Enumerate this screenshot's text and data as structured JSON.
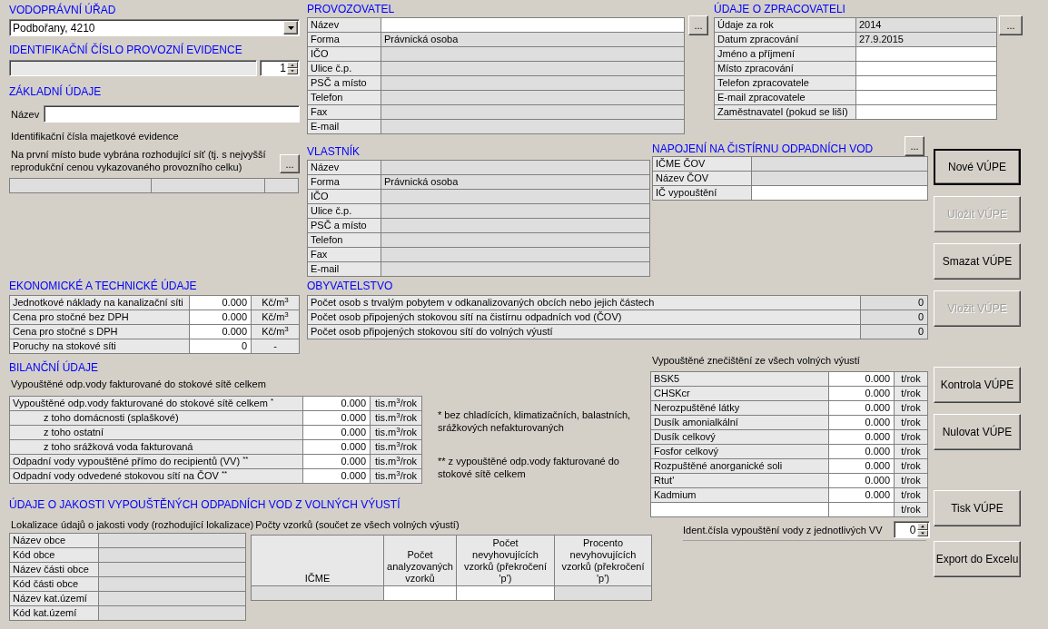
{
  "water_authority": {
    "heading": "VODOPRÁVNÍ ÚŘAD",
    "value": "Podbořany, 4210"
  },
  "operating_id": {
    "heading": "IDENTIFIKAČNÍ ČÍSLO PROVOZNÍ EVIDENCE",
    "spinner": "1"
  },
  "basic": {
    "heading": "ZÁKLADNÍ ÚDAJE",
    "name_label": "Název",
    "property_ids_label": "Identifikační čísla majetkové evidence",
    "note": "Na první místo bude vybrána rozhodující síť (tj. s nejvyšší reprodukční cenou vykazovaného provozního celku)",
    "browse": "..."
  },
  "operator": {
    "heading": "PROVOZOVATEL",
    "browse": "...",
    "rows": [
      {
        "label": "Název",
        "editable": true
      },
      {
        "label": "Forma",
        "value": "Právnická osoba",
        "editable": false
      },
      {
        "label": "IČO",
        "editable": false
      },
      {
        "label": "Ulice č.p.",
        "editable": false
      },
      {
        "label": "PSČ a místo",
        "editable": false
      },
      {
        "label": "Telefon",
        "editable": false
      },
      {
        "label": "Fax",
        "editable": false
      },
      {
        "label": "E-mail",
        "editable": false
      }
    ]
  },
  "processor": {
    "heading": "ÚDAJE O ZPRACOVATELI",
    "browse": "...",
    "rows": [
      {
        "label": "Údaje za rok",
        "value": "2014",
        "editable": false
      },
      {
        "label": "Datum zpracování",
        "value": "27.9.2015",
        "editable": false
      },
      {
        "label": "Jméno a příjmení",
        "editable": true
      },
      {
        "label": "Místo zpracování",
        "editable": true
      },
      {
        "label": "Telefon zpracovatele",
        "editable": true
      },
      {
        "label": "E-mail zpracovatele",
        "editable": true
      },
      {
        "label": "Zaměstnavatel (pokud se liší)",
        "editable": true
      }
    ]
  },
  "owner": {
    "heading": "VLASTNÍK",
    "rows": [
      {
        "label": "Název",
        "editable": false
      },
      {
        "label": "Forma",
        "value": "Právnická osoba",
        "editable": false
      },
      {
        "label": "IČO",
        "editable": false
      },
      {
        "label": "Ulice č.p.",
        "editable": false
      },
      {
        "label": "PSČ a místo",
        "editable": false
      },
      {
        "label": "Telefon",
        "editable": false
      },
      {
        "label": "Fax",
        "editable": false
      },
      {
        "label": "E-mail",
        "editable": false
      }
    ]
  },
  "treatment_plant": {
    "heading": "NAPOJENÍ NA ČISTÍRNU ODPADNÍCH VOD",
    "browse": "...",
    "rows": [
      {
        "label": "IČME ČOV",
        "editable": false
      },
      {
        "label": "Název ČOV",
        "editable": false
      },
      {
        "label": "IČ vypouštění",
        "editable": true
      }
    ]
  },
  "economic": {
    "heading": "EKONOMICKÉ A TECHNICKÉ ÚDAJE",
    "rows": [
      {
        "label": "Jednotkové náklady na kanalizační síti",
        "value": "0.000",
        "unit": "Kč/m$^{3}$"
      },
      {
        "label": "Cena pro stočné bez DPH",
        "value": "0.000",
        "unit": "Kč/m$^{3}$"
      },
      {
        "label": "Cena pro stočné s DPH",
        "value": "0.000",
        "unit": "Kč/m$^{3}$"
      },
      {
        "label": "Poruchy na stokové síti",
        "value": "0",
        "unit": "-"
      }
    ]
  },
  "population": {
    "heading": "OBYVATELSTVO",
    "rows": [
      {
        "label": "Počet osob s trvalým pobytem v odkanalizovaných obcích nebo jejich částech",
        "value": "0"
      },
      {
        "label": "Počet osob připojených stokovou sítí na čistírnu odpadních vod (ČOV)",
        "value": "0"
      },
      {
        "label": "Počet osob připojených stokovou sítí do volných výustí",
        "value": "0"
      }
    ]
  },
  "balance": {
    "heading": "BILANČNÍ ÚDAJE",
    "subheading": "Vypouštěné odp.vody fakturované do stokové sítě celkem",
    "rows": [
      {
        "label": "Vypouštěné odp.vody fakturované do stokové sítě celkem $^{*}$",
        "value": "0.000",
        "unit": "tis.m$^{3}$/rok",
        "children": [
          {
            "label": "z toho domácnosti (splaškové)",
            "value": "0.000",
            "unit": "tis.m$^{3}$/rok"
          },
          {
            "label": "z toho ostatní",
            "value": "0.000",
            "unit": "tis.m$^{3}$/rok"
          },
          {
            "label": "z toho srážková voda fakturovaná",
            "value": "0.000",
            "unit": "tis.m$^{3}$/rok"
          }
        ]
      },
      {
        "label": "Odpadní vody vypouštěné přímo do recipientů (VV) $^{**}$",
        "value": "0.000",
        "unit": "tis.m$^{3}$/rok"
      },
      {
        "label": "Odpadní vody odvedené stokovou sítí na ČOV $^{**}$",
        "value": "0.000",
        "unit": "tis.m$^{3}$/rok"
      }
    ],
    "notes": [
      "* bez chladících, klimatizačních, balastních, srážkových nefakturovaných",
      "** z vypouštěné odp.vody fakturované do stokové sítě celkem"
    ]
  },
  "pollution": {
    "heading": "Vypouštěné znečištění ze všech volných výustí",
    "rows": [
      {
        "label": "BSK5",
        "value": "0.000",
        "unit": "t/rok"
      },
      {
        "label": "CHSKcr",
        "value": "0.000",
        "unit": "t/rok"
      },
      {
        "label": "Nerozpuštěné látky",
        "value": "0.000",
        "unit": "t/rok"
      },
      {
        "label": "Dusík amonialkální",
        "value": "0.000",
        "unit": "t/rok"
      },
      {
        "label": "Dusík celkový",
        "value": "0.000",
        "unit": "t/rok"
      },
      {
        "label": "Fosfor celkový",
        "value": "0.000",
        "unit": "t/rok"
      },
      {
        "label": "Rozpuštěné anorganické soli",
        "value": "0.000",
        "unit": "t/rok"
      },
      {
        "label": "Rtut'",
        "value": "0.000",
        "unit": "t/rok"
      },
      {
        "label": "Kadmium",
        "value": "0.000",
        "unit": "t/rok"
      },
      {
        "unit": "t/rok"
      }
    ],
    "ident_label": "Ident.čísla vypouštění vody z jednotlivých VV",
    "ident_spinner": "0"
  },
  "quality": {
    "heading": "ÚDAJE O JAKOSTI VYPOUŠTĚNÝCH ODPADNÍCH VOD Z VOLNÝCH VÝUSTÍ",
    "location_label": "Lokalizace údajů o jakosti vody (rozhodující lokalizace)",
    "location_rows": [
      {
        "label": "Název obce"
      },
      {
        "label": "Kód obce"
      },
      {
        "label": "Název části obce"
      },
      {
        "label": "Kód části obce"
      },
      {
        "label": "Název kat.území"
      },
      {
        "label": "Kód kat.území"
      }
    ],
    "samples_label": "Počty vzorků (součet ze všech volných výustí)",
    "columns": [
      "IČME",
      "Počet analyzovaných vzorků",
      "Počet nevyhovujících vzorků (překročení 'p')",
      "Procento nevyhovujících vzorků (překročení 'p')"
    ],
    "row_editable": [
      false,
      true,
      true,
      false
    ]
  },
  "button_groups": [
    [
      {
        "label": "Nové VÚPE",
        "default": true,
        "disabled": false
      },
      {
        "label": "Uložit VÚPE",
        "default": false,
        "disabled": true
      },
      {
        "label": "Smazat VÚPE",
        "default": false,
        "disabled": false
      },
      {
        "label": "Vložit VÚPE",
        "default": false,
        "disabled": true
      }
    ],
    [
      {
        "label": "Kontrola VÚPE",
        "default": false,
        "disabled": false
      },
      {
        "label": "Nulovat VÚPE",
        "default": false,
        "disabled": false
      }
    ],
    [
      {
        "label": "Tisk VÚPE",
        "default": false,
        "disabled": false
      },
      {
        "label": "Export do Excelu",
        "default": false,
        "disabled": false
      }
    ]
  ]
}
